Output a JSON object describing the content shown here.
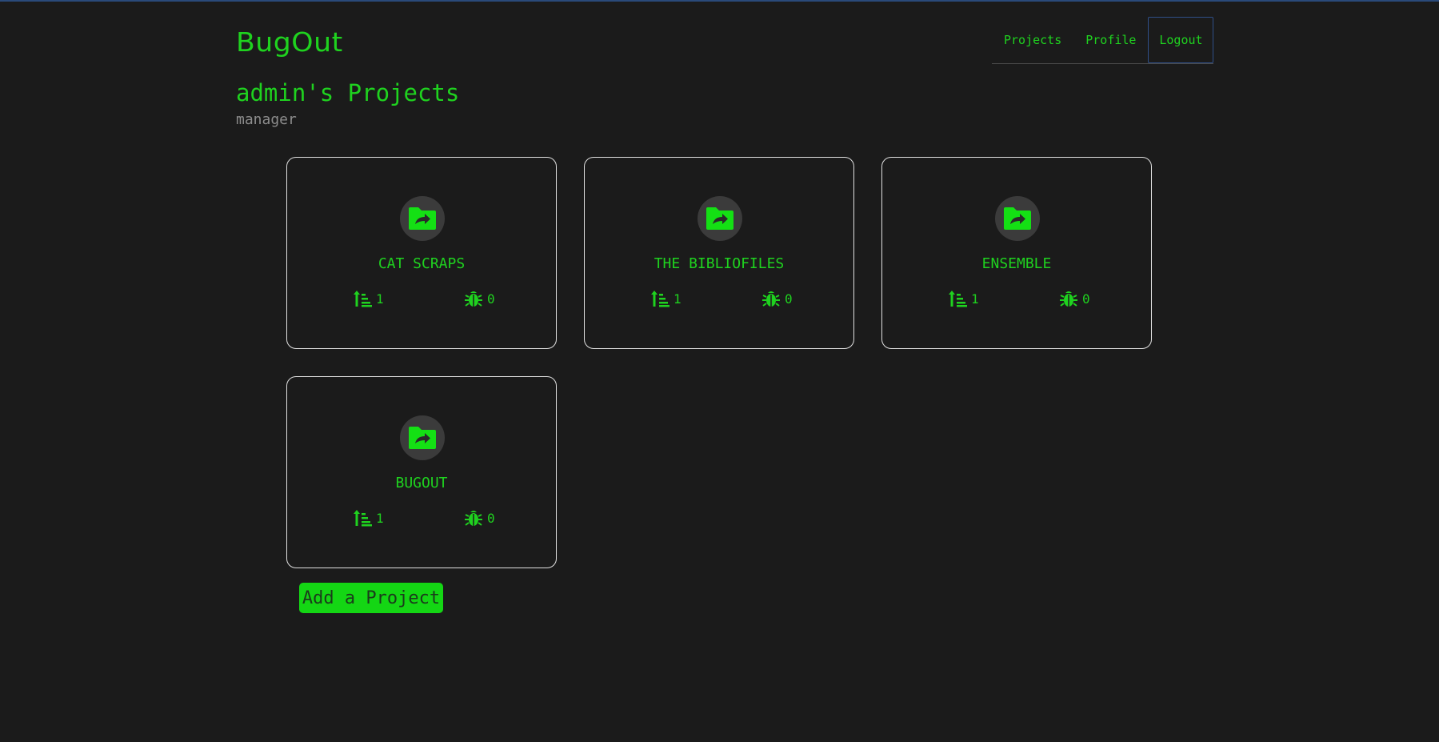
{
  "app": {
    "logo": "BugOut"
  },
  "nav": {
    "items": [
      {
        "label": "Projects"
      },
      {
        "label": "Profile"
      },
      {
        "label": "Logout"
      }
    ]
  },
  "header": {
    "title": "admin's Projects",
    "subtitle": "manager"
  },
  "projects": [
    {
      "name": "CAT SCRAPS",
      "tasks": "1",
      "bugs": "0"
    },
    {
      "name": "THE BIBLIOFILES",
      "tasks": "1",
      "bugs": "0"
    },
    {
      "name": "ENSEMBLE",
      "tasks": "1",
      "bugs": "0"
    },
    {
      "name": "BUGOUT",
      "tasks": "1",
      "bugs": "0"
    }
  ],
  "actions": {
    "add_project_label": "Add a Project"
  },
  "colors": {
    "background": "#1b1b1b",
    "accent": "#1fd21f",
    "card_border": "#e0e0e0",
    "icon_circle": "#3b3b3b",
    "subtitle": "#8c8c8c",
    "active_nav_border": "#2f4f88"
  },
  "icons": {
    "project": "folder-share-icon",
    "tasks": "sort-list-icon",
    "bugs": "bug-icon"
  }
}
